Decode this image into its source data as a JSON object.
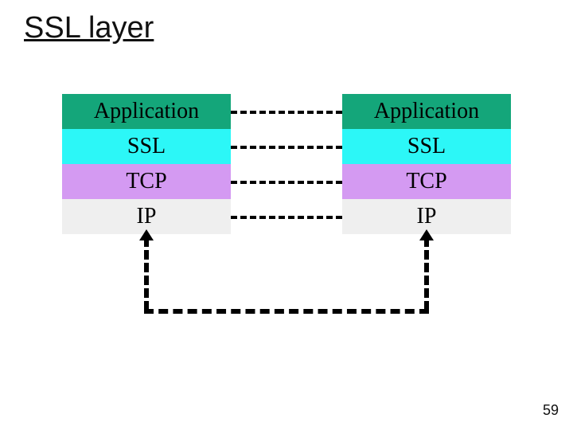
{
  "title": "SSL layer",
  "page_number": "59",
  "left_stack": {
    "application": "Application",
    "ssl": "SSL",
    "tcp": "TCP",
    "ip": "IP"
  },
  "right_stack": {
    "application": "Application",
    "ssl": "SSL",
    "tcp": "TCP",
    "ip": "IP"
  },
  "colors": {
    "application": "#14a67a",
    "ssl": "#2cf7f7",
    "tcp": "#d49af2",
    "ip": "#efefef"
  }
}
